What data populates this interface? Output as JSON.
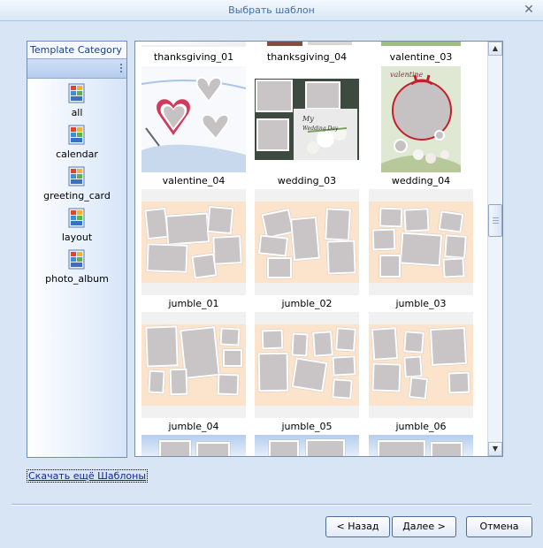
{
  "window": {
    "title": "Выбрать шаблон",
    "close_glyph": "✕"
  },
  "sidebar": {
    "header": "Template Category",
    "items": [
      {
        "label": "all",
        "icon": "template-icon"
      },
      {
        "label": "calendar",
        "icon": "template-icon"
      },
      {
        "label": "greeting_card",
        "icon": "template-icon"
      },
      {
        "label": "layout",
        "icon": "template-icon"
      },
      {
        "label": "photo_album",
        "icon": "template-icon"
      }
    ]
  },
  "grid": {
    "tiles": [
      {
        "label": "thanksgiving_01"
      },
      {
        "label": "thanksgiving_04"
      },
      {
        "label": "valentine_03"
      },
      {
        "label": "valentine_04"
      },
      {
        "label": "wedding_03"
      },
      {
        "label": "wedding_04"
      },
      {
        "label": "jumble_01"
      },
      {
        "label": "jumble_02"
      },
      {
        "label": "jumble_03"
      },
      {
        "label": "jumble_04"
      },
      {
        "label": "jumble_05"
      },
      {
        "label": "jumble_06"
      }
    ],
    "valentine_thumb_text": "valentine"
  },
  "link": {
    "text": "Скачать ещё Шаблоны"
  },
  "buttons": {
    "back": "< Назад",
    "next": "Далее >",
    "cancel": "Отмена"
  },
  "colors": {
    "accent": "#15428b",
    "link": "#10249b",
    "panel_border": "#6f8fb8"
  }
}
